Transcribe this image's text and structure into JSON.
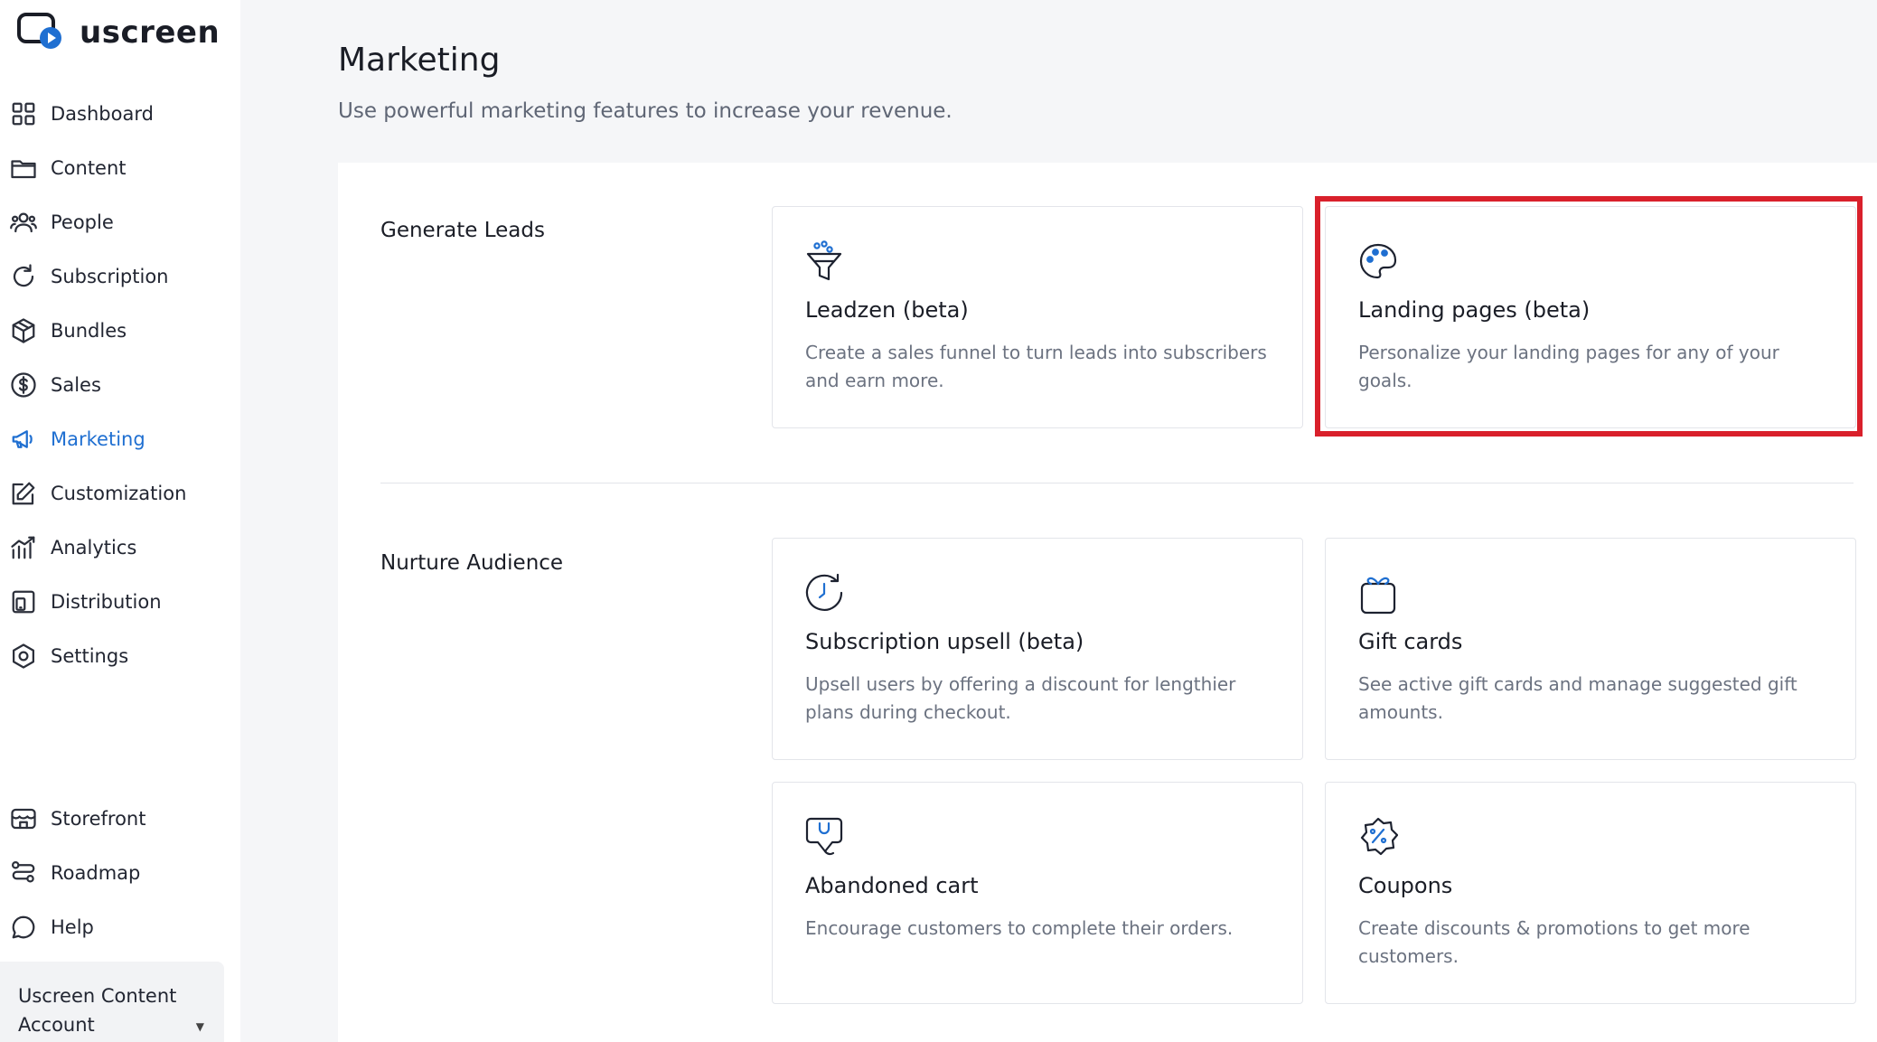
{
  "brand": {
    "name": "uscreen"
  },
  "sidebar": {
    "items": [
      {
        "label": "Dashboard",
        "icon": "grid-icon"
      },
      {
        "label": "Content",
        "icon": "folder-icon"
      },
      {
        "label": "People",
        "icon": "people-icon"
      },
      {
        "label": "Subscription",
        "icon": "refresh-icon"
      },
      {
        "label": "Bundles",
        "icon": "box-icon"
      },
      {
        "label": "Sales",
        "icon": "dollar-icon"
      },
      {
        "label": "Marketing",
        "icon": "megaphone-icon",
        "active": true
      },
      {
        "label": "Customization",
        "icon": "edit-icon"
      },
      {
        "label": "Analytics",
        "icon": "chart-icon"
      },
      {
        "label": "Distribution",
        "icon": "devices-icon"
      },
      {
        "label": "Settings",
        "icon": "gear-icon"
      }
    ],
    "bottom_items": [
      {
        "label": "Storefront",
        "icon": "store-icon"
      },
      {
        "label": "Roadmap",
        "icon": "roadmap-icon"
      },
      {
        "label": "Help",
        "icon": "chat-icon"
      }
    ],
    "account": {
      "line1": "Uscreen Content",
      "line2": "Account"
    }
  },
  "page": {
    "title": "Marketing",
    "subtitle": "Use powerful marketing features to increase your revenue."
  },
  "sections": [
    {
      "title": "Generate Leads",
      "cards": [
        {
          "title": "Leadzen (beta)",
          "description": "Create a sales funnel to turn leads into subscribers and earn more.",
          "icon": "funnel-icon"
        },
        {
          "title": "Landing pages (beta)",
          "description": "Personalize your landing pages for any of your goals.",
          "icon": "palette-icon"
        }
      ]
    },
    {
      "title": "Nurture Audience",
      "cards": [
        {
          "title": "Subscription upsell (beta)",
          "description": "Upsell users by offering a discount for lengthier plans during checkout.",
          "icon": "clock-refresh-icon"
        },
        {
          "title": "Gift cards",
          "description": "See active gift cards and manage suggested gift amounts.",
          "icon": "gift-icon"
        },
        {
          "title": "Abandoned cart",
          "description": "Encourage customers to complete their orders.",
          "icon": "cart-icon"
        },
        {
          "title": "Coupons",
          "description": "Create discounts & promotions to get more customers.",
          "icon": "coupon-icon"
        }
      ]
    }
  ],
  "colors": {
    "accent": "#1f6fd1",
    "highlight": "#d9202b"
  }
}
